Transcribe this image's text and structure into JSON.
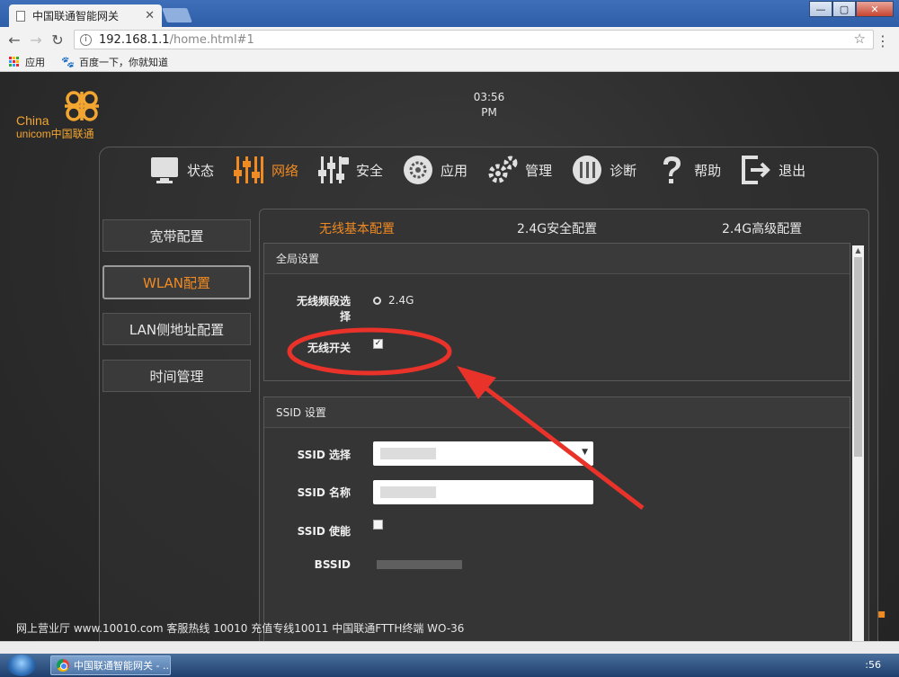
{
  "browser": {
    "tab_title": "中国联通智能网关",
    "tab_close": "✕",
    "url_host": "192.168.1.1",
    "url_path": "/home.html#1",
    "bookmarks": [
      {
        "label": "应用"
      },
      {
        "label": "百度一下，你就知道"
      }
    ],
    "window_buttons": [
      "—",
      "▢",
      "✕"
    ]
  },
  "logo": {
    "china": "China",
    "unicom": "unicom中国联通"
  },
  "clock": {
    "time": "03:56",
    "ampm": "PM"
  },
  "topnav": [
    {
      "key": "status",
      "label": "状态",
      "icon": "monitor-icon"
    },
    {
      "key": "network",
      "label": "网络",
      "icon": "sliders-icon",
      "active": true
    },
    {
      "key": "security",
      "label": "安全",
      "icon": "security-sliders-icon"
    },
    {
      "key": "apps",
      "label": "应用",
      "icon": "gear-icon"
    },
    {
      "key": "manage",
      "label": "管理",
      "icon": "gears-icon"
    },
    {
      "key": "diagnose",
      "label": "诊断",
      "icon": "wrench-icon"
    },
    {
      "key": "help",
      "label": "帮助",
      "icon": "question-icon"
    },
    {
      "key": "logout",
      "label": "退出",
      "icon": "exit-icon"
    }
  ],
  "sidebar": [
    {
      "label": "宽带配置"
    },
    {
      "label": "WLAN配置",
      "active": true
    },
    {
      "label": "LAN侧地址配置"
    },
    {
      "label": "时间管理"
    }
  ],
  "subtabs": [
    {
      "label": "无线基本配置",
      "active": true
    },
    {
      "label": "2.4G安全配置"
    },
    {
      "label": "2.4G高级配置"
    }
  ],
  "global_settings": {
    "title": "全局设置",
    "band_label": "无线频段选择",
    "band_value": "2.4G",
    "wireless_switch_label": "无线开关",
    "wireless_switch_checked": true
  },
  "ssid_settings": {
    "title": "SSID 设置",
    "ssid_select_label": "SSID 选择",
    "ssid_name_label": "SSID 名称",
    "ssid_enable_label": "SSID 使能",
    "ssid_enable_checked": false,
    "bssid_label": "BSSID"
  },
  "footer": {
    "text": "网上营业厅 www.10010.com 客服热线 10010 充值专线10011 中国联通FTTH终端 WO-36"
  },
  "taskbar": {
    "item_label": "中国联通智能网关 - ...",
    "clock": ":56"
  },
  "colors": {
    "accent": "#f08a22",
    "annotation": "#e8322a",
    "logo": "#f2a531"
  }
}
